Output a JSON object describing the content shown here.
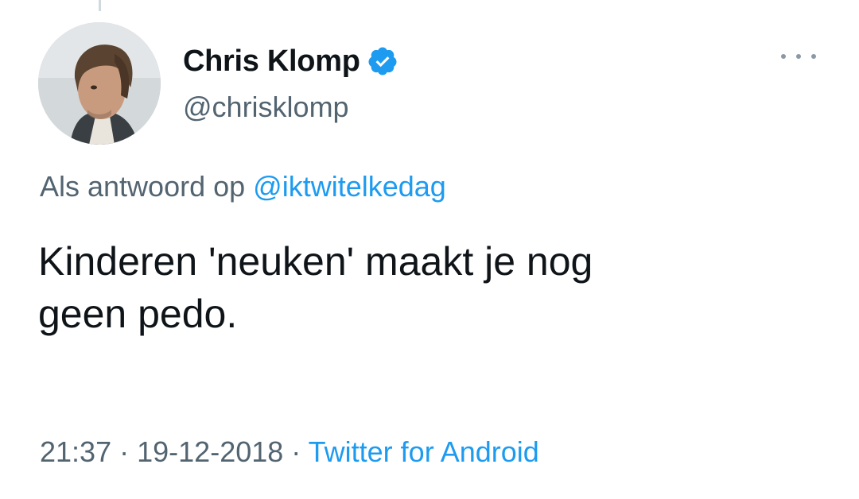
{
  "tweet": {
    "author": {
      "display_name": "Chris Klomp",
      "handle": "@chrisklomp",
      "verified_icon": "verified-badge-icon",
      "avatar_icon": "avatar-photo"
    },
    "more_icon": "more-options-icon",
    "reply_prefix": "Als antwoord op",
    "reply_to": "@iktwitelkedag",
    "text": "Kinderen 'neuken' maakt je nog\ngeen pedo.",
    "time": "21:37",
    "separator": "·",
    "date": "19-12-2018",
    "source": "Twitter for Android"
  },
  "colors": {
    "link": "#1d9bf0",
    "secondary_text": "#536471",
    "primary_text": "#0f1419",
    "background": "#ffffff"
  }
}
